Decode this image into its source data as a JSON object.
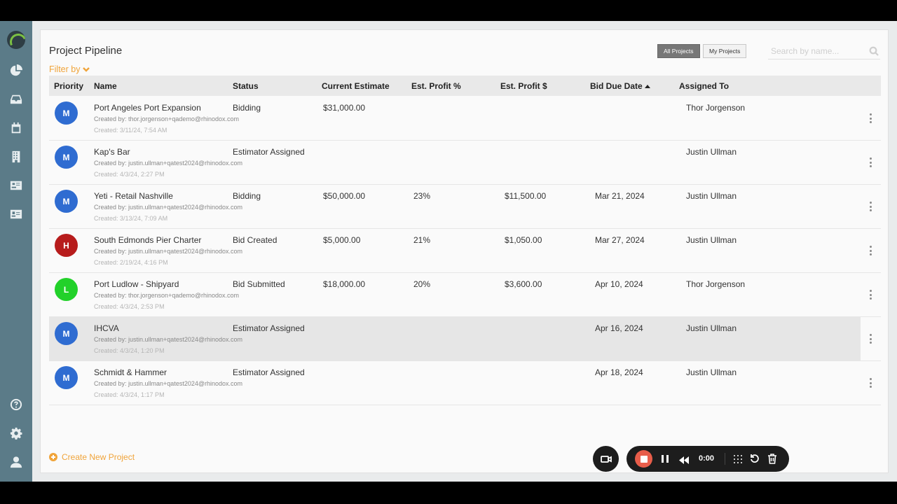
{
  "app": {
    "title": "Project Pipeline"
  },
  "filter": {
    "label": "Filter by"
  },
  "view_toggle": {
    "all_label": "All Projects",
    "mine_label": "My Projects",
    "selected": "All Projects"
  },
  "search": {
    "placeholder": "Search by name...",
    "value": ""
  },
  "table": {
    "columns": [
      "Priority",
      "Name",
      "Status",
      "Current Estimate",
      "Est. Profit %",
      "Est. Profit $",
      "Bid Due Date",
      "Assigned To"
    ],
    "sorted_by": "Bid Due Date",
    "sort_direction": "ascending",
    "rows": [
      {
        "priority": "M",
        "priority_color": "#2f6cd1",
        "name": "Port Angeles Port Expansion",
        "created_by": "Created by: thor.jorgenson+qademo@rhinodox.com",
        "created_date": "Created: 3/11/24, 7:54 AM",
        "status": "Bidding",
        "estimate": "$31,000.00",
        "profit_pct": "",
        "profit_amt": "",
        "due": "",
        "assigned": "Thor Jorgenson",
        "highlighted": false
      },
      {
        "priority": "M",
        "priority_color": "#2f6cd1",
        "name": "Kap's Bar",
        "created_by": "Created by: justin.ullman+qatest2024@rhinodox.com",
        "created_date": "Created: 4/3/24, 2:27 PM",
        "status": "Estimator Assigned",
        "estimate": "",
        "profit_pct": "",
        "profit_amt": "",
        "due": "",
        "assigned": "Justin Ullman",
        "highlighted": false
      },
      {
        "priority": "M",
        "priority_color": "#2f6cd1",
        "name": "Yeti - Retail Nashville",
        "created_by": "Created by: justin.ullman+qatest2024@rhinodox.com",
        "created_date": "Created: 3/13/24, 7:09 AM",
        "status": "Bidding",
        "estimate": "$50,000.00",
        "profit_pct": "23%",
        "profit_amt": "$11,500.00",
        "due": "Mar 21, 2024",
        "assigned": "Justin Ullman",
        "highlighted": false
      },
      {
        "priority": "H",
        "priority_color": "#b71c1c",
        "name": "South Edmonds Pier Charter",
        "created_by": "Created by: justin.ullman+qatest2024@rhinodox.com",
        "created_date": "Created: 2/19/24, 4:16 PM",
        "status": "Bid Created",
        "estimate": "$5,000.00",
        "profit_pct": "21%",
        "profit_amt": "$1,050.00",
        "due": "Mar 27, 2024",
        "assigned": "Justin Ullman",
        "highlighted": false
      },
      {
        "priority": "L",
        "priority_color": "#22d12a",
        "name": "Port Ludlow - Shipyard",
        "created_by": "Created by: thor.jorgenson+qademo@rhinodox.com",
        "created_date": "Created: 4/3/24, 2:53 PM",
        "status": "Bid Submitted",
        "estimate": "$18,000.00",
        "profit_pct": "20%",
        "profit_amt": "$3,600.00",
        "due": "Apr 10, 2024",
        "assigned": "Thor Jorgenson",
        "highlighted": false
      },
      {
        "priority": "M",
        "priority_color": "#2f6cd1",
        "name": "IHCVA",
        "created_by": "Created by: justin.ullman+qatest2024@rhinodox.com",
        "created_date": "Created: 4/3/24, 1:20 PM",
        "status": "Estimator Assigned",
        "estimate": "",
        "profit_pct": "",
        "profit_amt": "",
        "due": "Apr 16, 2024",
        "assigned": "Justin Ullman",
        "highlighted": true
      },
      {
        "priority": "M",
        "priority_color": "#2f6cd1",
        "name": "Schmidt & Hammer",
        "created_by": "Created by: justin.ullman+qatest2024@rhinodox.com",
        "created_date": "Created: 4/3/24, 1:17 PM",
        "status": "Estimator Assigned",
        "estimate": "",
        "profit_pct": "",
        "profit_amt": "",
        "due": "Apr 18, 2024",
        "assigned": "Justin Ullman",
        "highlighted": false
      }
    ]
  },
  "actions": {
    "create_label": "Create New Project"
  },
  "recorder": {
    "time": "0:00"
  },
  "sidebar": {
    "icons": [
      "logo-icon",
      "dashboard-pie-icon",
      "inbox-icon",
      "calendar-icon",
      "building-icon",
      "contact-card-icon",
      "id-card-icon",
      "help-icon",
      "settings-icon",
      "user-icon"
    ]
  },
  "colors": {
    "accent": "#f0a43a",
    "sidebar": "#5b7b88",
    "priority_medium": "#2f6cd1",
    "priority_high": "#b71c1c",
    "priority_low": "#22d12a"
  }
}
